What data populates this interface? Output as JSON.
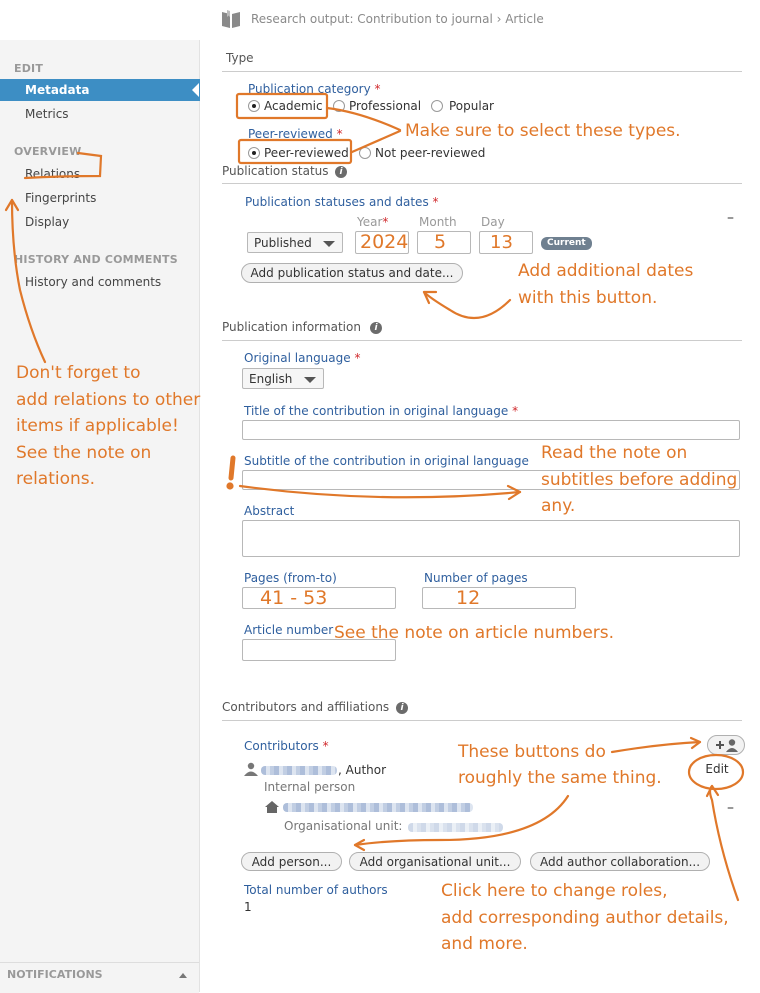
{
  "header": {
    "title": "Research output: Contribution to journal › Article",
    "icon": "book-icon"
  },
  "sidebar": {
    "edit_heading": "EDIT",
    "items_edit": [
      {
        "label": "Metadata"
      },
      {
        "label": "Metrics"
      }
    ],
    "overview_heading": "OVERVIEW",
    "items_overview": [
      {
        "label": "Relations"
      },
      {
        "label": "Fingerprints"
      },
      {
        "label": "Display"
      }
    ],
    "history_heading": "HISTORY AND COMMENTS",
    "items_history": [
      {
        "label": "History and comments"
      }
    ],
    "notifications": "NOTIFICATIONS"
  },
  "type_section": {
    "title": "Type",
    "category_label": "Publication category",
    "category_options": [
      "Academic",
      "Professional",
      "Popular"
    ],
    "category_selected": "Academic",
    "peer_label": "Peer-reviewed",
    "peer_options": [
      "Peer-reviewed",
      "Not peer-reviewed"
    ],
    "peer_selected": "Peer-reviewed"
  },
  "status_section": {
    "title": "Publication status",
    "statuses_label": "Publication statuses and dates",
    "year_label": "Year",
    "month_label": "Month",
    "day_label": "Day",
    "status_value": "Published",
    "year_value": "2024",
    "month_value": "5",
    "day_value": "13",
    "current_badge": "Current",
    "add_button": "Add publication status and date..."
  },
  "info_section": {
    "title": "Publication information",
    "language_label": "Original language",
    "language_value": "English",
    "title_label": "Title of the contribution in original language",
    "subtitle_label": "Subtitle of the contribution in original language",
    "abstract_label": "Abstract",
    "pages_label": "Pages (from-to)",
    "pages_value": "41 - 53",
    "num_pages_label": "Number of pages",
    "num_pages_value": "12",
    "article_number_label": "Article number"
  },
  "contrib_section": {
    "title": "Contributors and affiliations",
    "contributors_label": "Contributors",
    "author_role": ", Author",
    "person_type": "Internal person",
    "org_unit_label": "Organisational unit:",
    "edit_button": "Edit",
    "add_person": "Add person...",
    "add_org": "Add organisational unit...",
    "add_collab": "Add author collaboration...",
    "total_label": "Total number of authors",
    "total_value": "1"
  },
  "annotations": {
    "types": "Make sure to select these types.",
    "dates": [
      "Add additional dates",
      "with this button."
    ],
    "relations": [
      "Don't forget to",
      "add relations to other",
      "items if applicable!",
      "See the note on",
      "relations."
    ],
    "subtitles": [
      "Read the note on",
      "subtitles before adding",
      "any."
    ],
    "article_numbers": "See the note on article numbers.",
    "buttons": [
      "These buttons do",
      "roughly the same thing."
    ],
    "roles": [
      "Click here to change roles,",
      "add corresponding author details,",
      "and more."
    ]
  },
  "colors": {
    "accent": "#3d8ec4",
    "annotation": "#e0782a",
    "label": "#2f5f9e",
    "required": "#d0272a"
  }
}
